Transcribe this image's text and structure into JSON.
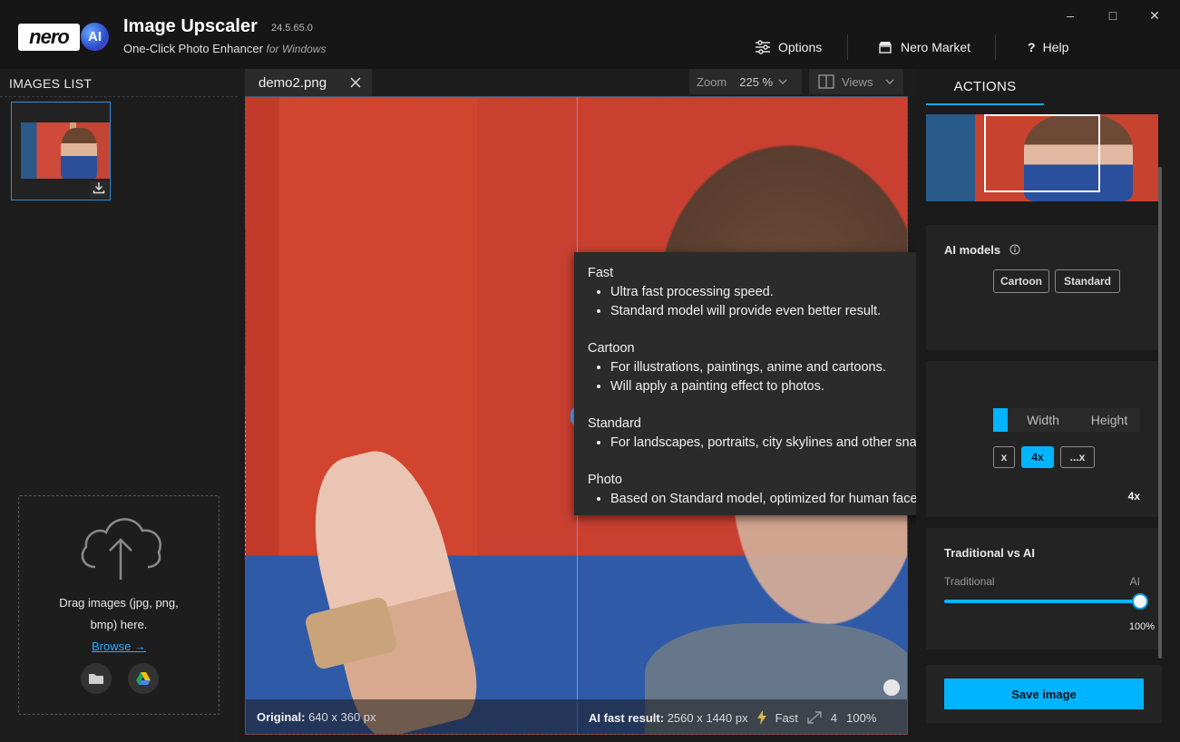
{
  "app": {
    "logo": "nero",
    "logo_badge": "AI",
    "title": "Image Upscaler",
    "version": "24.5.65.0",
    "subtitle": "One-Click Photo Enhancer",
    "subtitle_platform": "for Windows"
  },
  "toolbar": {
    "options_label": "Options",
    "market_label": "Nero Market",
    "help_label": "Help",
    "help_glyph": "?"
  },
  "window_controls": {
    "minimize": "–",
    "maximize": "□",
    "close": "✕"
  },
  "images_list": {
    "title": "IMAGES LIST",
    "dropzone_text": "Drag images (jpg, png, bmp) here.",
    "browse_label": "Browse →"
  },
  "tabs": [
    {
      "label": "demo2.png"
    }
  ],
  "zoom": {
    "label": "Zoom",
    "value": "225 %"
  },
  "views": {
    "label": "Views"
  },
  "status": {
    "original_label": "Original:",
    "original_value": "640 x 360 px",
    "result_label": "AI fast result:",
    "result_value": "2560 x 1440 px",
    "mode": "Fast",
    "scale": "4",
    "strength": "100%"
  },
  "tooltip": {
    "sections": [
      {
        "title": "Fast",
        "bullets": [
          "Ultra fast processing speed.",
          "Standard model will provide even better result."
        ]
      },
      {
        "title": "Cartoon",
        "bullets": [
          "For illustrations, paintings, anime and cartoons.",
          "Will apply a painting effect to photos."
        ]
      },
      {
        "title": "Standard",
        "bullets": [
          "For landscapes, portraits, city skylines and other snapshots."
        ]
      },
      {
        "title": "Photo",
        "bullets": [
          "Based on Standard model, optimized for human faces."
        ]
      }
    ]
  },
  "actions": {
    "tab_label": "ACTIONS",
    "ai_models": {
      "title": "AI models",
      "chips": [
        "Cartoon",
        "Standard"
      ]
    },
    "scale": {
      "segments": [
        "Width",
        "Height"
      ],
      "chips": [
        {
          "label": "x",
          "active": false
        },
        {
          "label": "4x",
          "active": true
        },
        {
          "label": "...x",
          "active": false
        }
      ],
      "value": "4x"
    },
    "traditional_vs_ai": {
      "title": "Traditional vs AI",
      "left_label": "Traditional",
      "right_label": "AI",
      "value_label": "100%",
      "value": 1.0
    },
    "save_label": "Save image"
  },
  "colors": {
    "accent": "#00b4ff",
    "link": "#2fa7ff",
    "background": "#1b1b1b"
  }
}
